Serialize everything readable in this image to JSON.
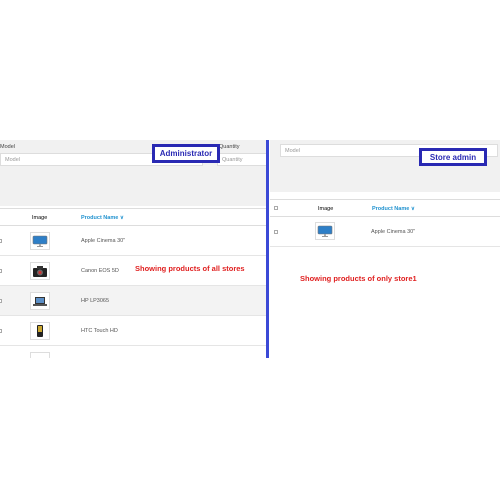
{
  "left": {
    "filters": {
      "model_label": "Model",
      "model_placeholder": "Model",
      "quantity_label": "Quantity",
      "quantity_placeholder": "Quantity"
    },
    "callout": "Administrator",
    "table": {
      "image_header": "Image",
      "name_header": "Product Name ∨",
      "rows": [
        {
          "name": "Apple Cinema 30\"",
          "icon": "monitor-icon"
        },
        {
          "name": "Canon EOS 5D",
          "icon": "camera-icon"
        },
        {
          "name": "HP LP3065",
          "icon": "laptop-icon"
        },
        {
          "name": "HTC Touch HD",
          "icon": "phone-icon"
        }
      ]
    },
    "note": "Showing products of all stores"
  },
  "right": {
    "filters": {
      "model_placeholder": "Model"
    },
    "callout": "Store admin",
    "table": {
      "image_header": "Image",
      "name_header": "Product Name ∨",
      "rows": [
        {
          "name": "Apple Cinema 30\"",
          "icon": "monitor-icon"
        }
      ]
    },
    "note": "Showing products of only store1"
  },
  "colors": {
    "callout_border": "#2929b3",
    "divider": "#3b49d6",
    "note": "#e02020",
    "link": "#1e91cf"
  }
}
